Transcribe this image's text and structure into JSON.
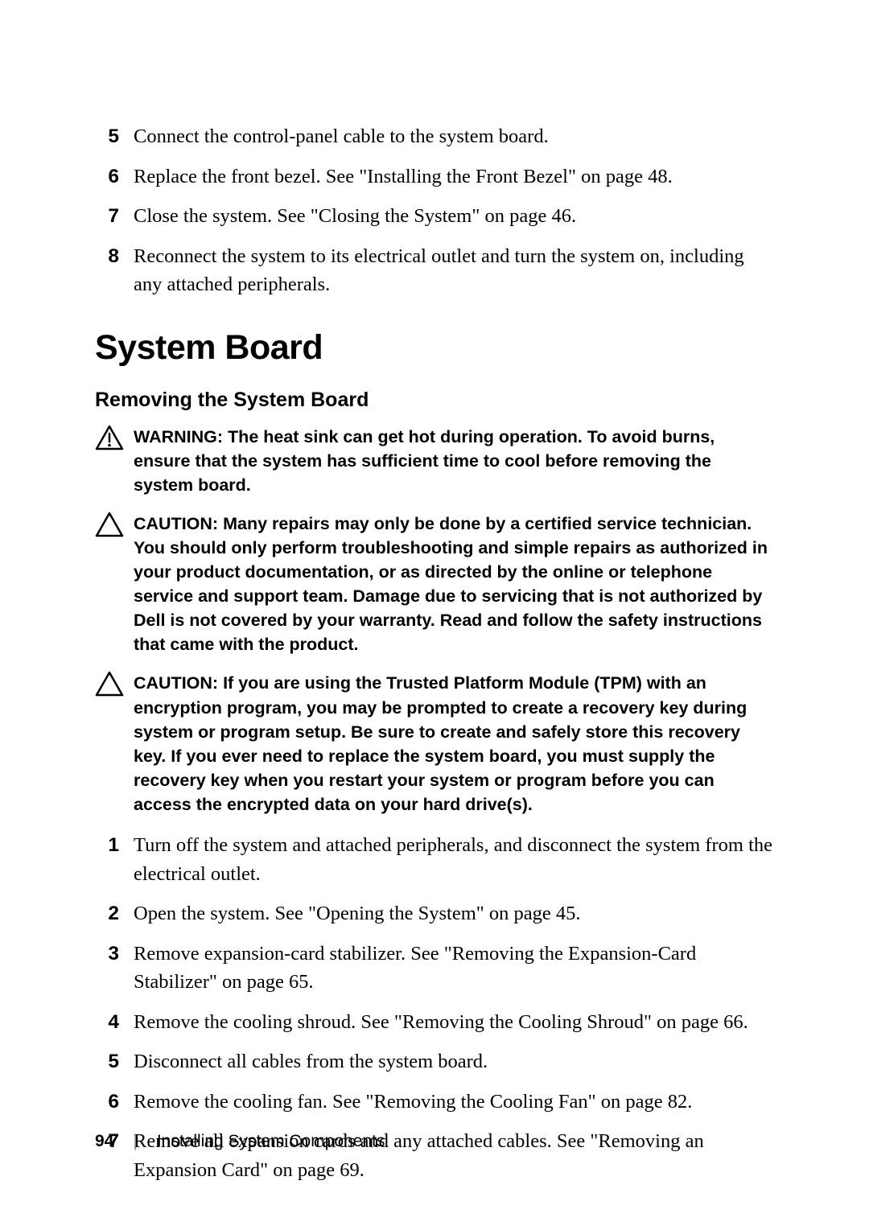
{
  "top_steps": [
    {
      "n": "5",
      "t": "Connect the control-panel cable to the system board."
    },
    {
      "n": "6",
      "t": "Replace the front bezel. See \"Installing the Front Bezel\" on page 48."
    },
    {
      "n": "7",
      "t": "Close the system. See \"Closing the System\" on page 46."
    },
    {
      "n": "8",
      "t": "Reconnect the system to its electrical outlet and turn the system on, including any attached peripherals."
    }
  ],
  "heading": "System Board",
  "subheading": "Removing the System Board",
  "warning": {
    "label": "WARNING:",
    "text": " The heat sink can get hot during operation. To avoid burns, ensure that the system has sufficient time to cool before removing the system board."
  },
  "caution1": {
    "label": "CAUTION:",
    "text": " Many repairs may only be done by a certified service technician. You should only perform troubleshooting and simple repairs as authorized in your product documentation, or as directed by the online or telephone service and support team. Damage due to servicing that is not authorized by Dell is not covered by your warranty. Read and follow the safety instructions that came with the product."
  },
  "caution2": {
    "label": "CAUTION:",
    "text": " If you are using the Trusted Platform Module (TPM) with an encryption program, you may be prompted to create a recovery key during system or program setup. Be sure to create and safely store this recovery key. If you ever need to replace the system board, you must supply the recovery key when you restart your system or program before you can access the encrypted data on your hard drive(s)."
  },
  "bottom_steps": [
    {
      "n": "1",
      "t": "Turn off the system and attached peripherals, and disconnect the system from the electrical outlet."
    },
    {
      "n": "2",
      "t": "Open the system. See \"Opening the System\" on page 45."
    },
    {
      "n": "3",
      "t": "Remove expansion-card stabilizer. See \"Removing the Expansion-Card Stabilizer\" on page 65."
    },
    {
      "n": "4",
      "t": "Remove the cooling shroud. See \"Removing the Cooling Shroud\" on page 66."
    },
    {
      "n": "5",
      "t": "Disconnect all cables from the system board."
    },
    {
      "n": "6",
      "t": "Remove the cooling fan. See \"Removing the Cooling Fan\" on page 82."
    },
    {
      "n": "7",
      "t": "Remove all expansion cards and any attached cables. See \"Removing an Expansion Card\" on page 69."
    }
  ],
  "footer": {
    "page": "94",
    "sep": "|",
    "chapter": "Installing System Components"
  }
}
